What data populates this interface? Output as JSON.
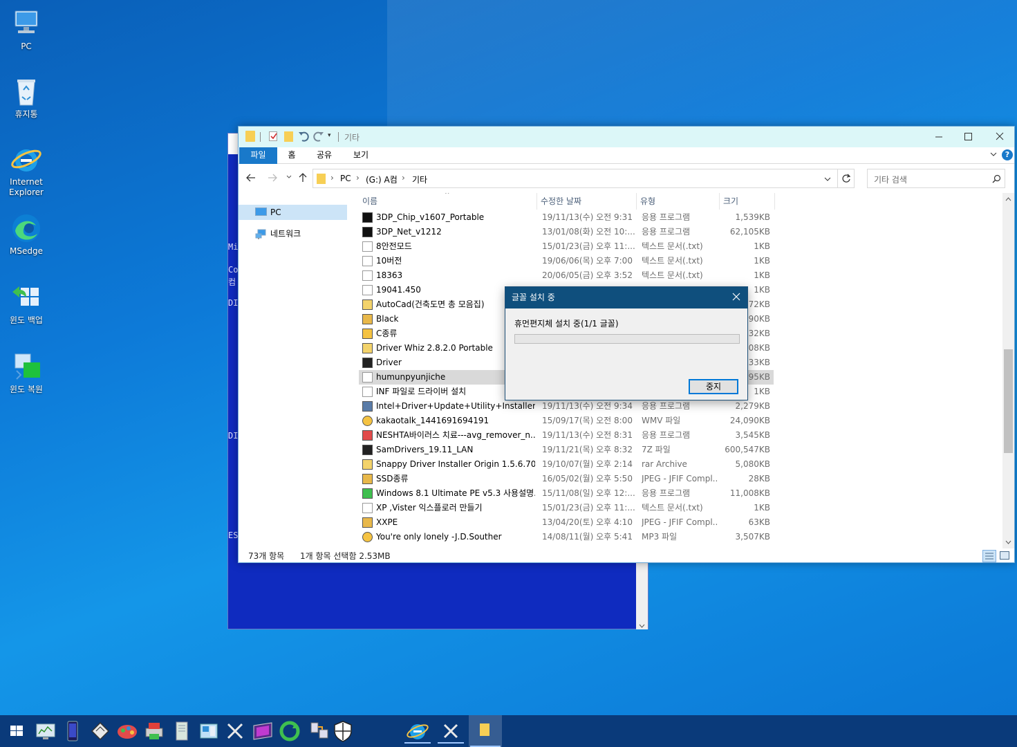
{
  "desktop": {
    "icons": [
      {
        "label": "PC"
      },
      {
        "label": "휴지통"
      },
      {
        "label": "Internet Explorer"
      },
      {
        "label": "MSedge"
      },
      {
        "label": "윈도 백업"
      },
      {
        "label": "윈도 복원"
      }
    ]
  },
  "console": {
    "fragments": [
      "Mi",
      "Co",
      "컴",
      "DI",
      "DI",
      "ES"
    ]
  },
  "explorer": {
    "title": "기타",
    "ribbon_tabs": [
      "파일",
      "홈",
      "공유",
      "보기"
    ],
    "breadcrumb": [
      "PC",
      "(G:) A컴",
      "기타"
    ],
    "search_placeholder": "기타 검색",
    "nav": [
      {
        "label": "PC"
      },
      {
        "label": "네트워크"
      }
    ],
    "columns": {
      "name": "이름",
      "date": "수정한 날짜",
      "type": "유형",
      "size": "크기"
    },
    "files": [
      {
        "name": "3DP_Chip_v1607_Portable",
        "date": "19/11/13(수) 오전 9:31",
        "type": "응용 프로그램",
        "size": "1,539KB",
        "icon": "3dp-chip-icon"
      },
      {
        "name": "3DP_Net_v1212",
        "date": "13/01/08(화) 오전 10:...",
        "type": "응용 프로그램",
        "size": "62,105KB",
        "icon": "3dp-net-icon"
      },
      {
        "name": "8안전모드",
        "date": "15/01/23(금) 오후 11:...",
        "type": "텍스트 문서(.txt)",
        "size": "1KB",
        "icon": "text-file-icon"
      },
      {
        "name": "10버전",
        "date": "19/06/06(목) 오후 7:00",
        "type": "텍스트 문서(.txt)",
        "size": "1KB",
        "icon": "text-file-icon"
      },
      {
        "name": "18363",
        "date": "20/06/05(금) 오후 3:52",
        "type": "텍스트 문서(.txt)",
        "size": "1KB",
        "icon": "text-file-icon"
      },
      {
        "name": "19041.450",
        "date": "",
        "type": "",
        "size": "1KB",
        "icon": "text-file-icon"
      },
      {
        "name": "AutoCad(건축도면 총 모음집)",
        "date": "",
        "type": "",
        "size": "72KB",
        "icon": "archive-icon"
      },
      {
        "name": "Black",
        "date": "",
        "type": "",
        "size": "490KB",
        "icon": "jpeg-icon"
      },
      {
        "name": "C종류",
        "date": "",
        "type": "",
        "size": "432KB",
        "icon": "pdf-icon"
      },
      {
        "name": "Driver Whiz 2.8.2.0 Portable",
        "date": "",
        "type": "",
        "size": "308KB",
        "icon": "archive-icon"
      },
      {
        "name": "Driver",
        "date": "",
        "type": "",
        "size": "433KB",
        "icon": "7z-icon"
      },
      {
        "name": "humunpyunjiche",
        "date": "",
        "type": "",
        "size": "595KB",
        "icon": "font-file-icon"
      },
      {
        "name": "INF 파일로 드라이버 설치",
        "date": "",
        "type": "",
        "size": "1KB",
        "icon": "text-file-icon"
      },
      {
        "name": "Intel+Driver+Update+Utility+Installer",
        "date": "19/11/13(수) 오전 9:34",
        "type": "응용 프로그램",
        "size": "2,279KB",
        "icon": "installer-icon"
      },
      {
        "name": "kakaotalk_1441691694191",
        "date": "15/09/17(목) 오전 8:00",
        "type": "WMV 파일",
        "size": "24,090KB",
        "icon": "media-icon"
      },
      {
        "name": "NESHTA바이러스 치료---avg_remover_n...",
        "date": "19/11/13(수) 오전 8:31",
        "type": "응용 프로그램",
        "size": "3,545KB",
        "icon": "avg-icon"
      },
      {
        "name": "SamDrivers_19.11_LAN",
        "date": "19/11/21(목) 오후 8:32",
        "type": "7Z 파일",
        "size": "600,547KB",
        "icon": "7z-icon"
      },
      {
        "name": "Snappy Driver Installer Origin 1.5.6.705 ...",
        "date": "19/10/07(월) 오후 2:14",
        "type": "rar Archive",
        "size": "5,080KB",
        "icon": "archive-icon"
      },
      {
        "name": "SSD종류",
        "date": "16/05/02(월) 오후 5:50",
        "type": "JPEG - JFIF Compl...",
        "size": "28KB",
        "icon": "jpeg-icon"
      },
      {
        "name": "Windows 8.1 Ultimate PE v5.3 사용설명...",
        "date": "15/11/08(일) 오후 12:...",
        "type": "응용 프로그램",
        "size": "11,008KB",
        "icon": "book-icon"
      },
      {
        "name": "XP ,Vister 익스플로러 만들기",
        "date": "15/01/23(금) 오후 11:...",
        "type": "텍스트 문서(.txt)",
        "size": "1KB",
        "icon": "text-file-icon"
      },
      {
        "name": "XXPE",
        "date": "13/04/20(토) 오후 4:10",
        "type": "JPEG - JFIF Compl...",
        "size": "63KB",
        "icon": "jpeg-icon"
      },
      {
        "name": "You're only lonely -J.D.Souther",
        "date": "14/08/11(월) 오후 5:41",
        "type": "MP3 파일",
        "size": "3,507KB",
        "icon": "media-icon"
      }
    ],
    "selected_index": 11,
    "status": {
      "count": "73개 항목",
      "selection": "1개 항목 선택함 2.53MB"
    }
  },
  "dialog": {
    "title": "글꼴 설치 중",
    "message": "휴먼편지체 설치 중(1/1 글꼴)",
    "progress": 0,
    "button": "중지"
  },
  "taskbar": {
    "pinned": [
      "start-icon",
      "system-monitor-icon",
      "phone-icon",
      "disk-icon",
      "paint-icon",
      "printer-icon",
      "documents-icon",
      "control-panel-icon",
      "tools-icon",
      "media-player-icon",
      "sync-icon",
      "network-icon",
      "shield-icon",
      "ie-icon",
      "tools-icon",
      "file-explorer-icon"
    ]
  },
  "colors": {
    "accent": "#1979ca",
    "titlebar": "#dcf7f8",
    "dialog_title": "#0f4f7d",
    "taskbar": "#0a3a7a",
    "selection": "#d9d9d9"
  }
}
